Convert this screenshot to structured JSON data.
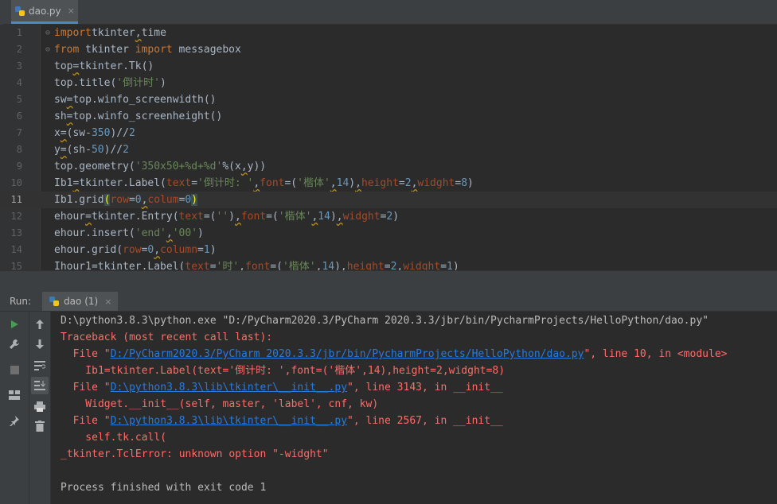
{
  "editor_tab": {
    "name": "dao.py",
    "close": "×"
  },
  "code_lines": [
    {
      "n": "1",
      "segs": [
        [
          "kw",
          "import"
        ],
        [
          "",
          "tkinter"
        ],
        [
          "wv",
          ","
        ],
        [
          "",
          "time"
        ]
      ]
    },
    {
      "n": "2",
      "segs": [
        [
          "kw",
          "from"
        ],
        [
          "",
          " tkinter "
        ],
        [
          "kw",
          "import"
        ],
        [
          "",
          " messagebox"
        ]
      ]
    },
    {
      "n": "3",
      "segs": [
        [
          "",
          "top"
        ],
        [
          "wv",
          "="
        ],
        [
          "",
          "tkinter.Tk()"
        ]
      ]
    },
    {
      "n": "4",
      "segs": [
        [
          "",
          "top.title("
        ],
        [
          "st",
          "'倒计时'"
        ],
        [
          "",
          ")"
        ]
      ]
    },
    {
      "n": "5",
      "segs": [
        [
          "",
          "sw"
        ],
        [
          "wv",
          "="
        ],
        [
          "",
          "top.winfo_screenwidth()"
        ]
      ]
    },
    {
      "n": "6",
      "segs": [
        [
          "",
          "sh"
        ],
        [
          "wv",
          "="
        ],
        [
          "",
          "top.winfo_screenheight()"
        ]
      ]
    },
    {
      "n": "7",
      "segs": [
        [
          "",
          "x"
        ],
        [
          "wv",
          "="
        ],
        [
          "",
          "(sw-"
        ],
        [
          "nu",
          "350"
        ],
        [
          "",
          ")//"
        ],
        [
          "nu",
          "2"
        ]
      ]
    },
    {
      "n": "8",
      "segs": [
        [
          "",
          "y"
        ],
        [
          "wv",
          "="
        ],
        [
          "",
          "(sh-"
        ],
        [
          "nu",
          "50"
        ],
        [
          "",
          ")//"
        ],
        [
          "nu",
          "2"
        ]
      ]
    },
    {
      "n": "9",
      "segs": [
        [
          "",
          "top.geometry("
        ],
        [
          "st",
          "'350x50+%d+%d'"
        ],
        [
          "",
          "%(x"
        ],
        [
          "wv",
          ","
        ],
        [
          "",
          "y))"
        ]
      ]
    },
    {
      "n": "10",
      "segs": [
        [
          "",
          "Ib1"
        ],
        [
          "wv",
          "="
        ],
        [
          "",
          "tkinter.Label("
        ],
        [
          "pa",
          "text"
        ],
        [
          "",
          "="
        ],
        [
          "st",
          "'倒计时: '"
        ],
        [
          "wv",
          ","
        ],
        [
          "pa",
          "font"
        ],
        [
          "",
          "=("
        ],
        [
          "st",
          "'楷体'"
        ],
        [
          "wv",
          ","
        ],
        [
          "nu",
          "14"
        ],
        [
          "",
          ")"
        ],
        [
          "wv",
          ","
        ],
        [
          "pa",
          "height"
        ],
        [
          "",
          "="
        ],
        [
          "nu",
          "2"
        ],
        [
          "wv",
          ","
        ],
        [
          "pa",
          "widght"
        ],
        [
          "",
          "="
        ],
        [
          "nu",
          "8"
        ],
        [
          "",
          ")"
        ]
      ]
    },
    {
      "n": "11",
      "segs": [
        [
          "",
          "Ib1.grid"
        ],
        [
          "br",
          "("
        ],
        [
          "pa",
          "row"
        ],
        [
          "",
          "="
        ],
        [
          "nu",
          "0"
        ],
        [
          "wv",
          ","
        ],
        [
          "pa",
          "colum"
        ],
        [
          "",
          "="
        ],
        [
          "nu",
          "0"
        ],
        [
          "br",
          ")"
        ]
      ]
    },
    {
      "n": "12",
      "segs": [
        [
          "",
          "ehour"
        ],
        [
          "wv",
          "="
        ],
        [
          "",
          "tkinter.Entry("
        ],
        [
          "pa",
          "text"
        ],
        [
          "",
          "=("
        ],
        [
          "st",
          "''"
        ],
        [
          "",
          ")"
        ],
        [
          "wv",
          ","
        ],
        [
          "pa",
          "font"
        ],
        [
          "",
          "=("
        ],
        [
          "st",
          "'楷体'"
        ],
        [
          "wv",
          ","
        ],
        [
          "nu",
          "14"
        ],
        [
          "",
          ")"
        ],
        [
          "wv",
          ","
        ],
        [
          "pa",
          "widght"
        ],
        [
          "",
          "="
        ],
        [
          "nu",
          "2"
        ],
        [
          "",
          ")"
        ]
      ]
    },
    {
      "n": "13",
      "segs": [
        [
          "",
          "ehour.insert("
        ],
        [
          "st",
          "'end'"
        ],
        [
          "wv",
          ","
        ],
        [
          "st",
          "'00'"
        ],
        [
          "",
          ")"
        ]
      ]
    },
    {
      "n": "14",
      "segs": [
        [
          "",
          "ehour.grid("
        ],
        [
          "pa",
          "row"
        ],
        [
          "",
          "="
        ],
        [
          "nu",
          "0"
        ],
        [
          "wv",
          ","
        ],
        [
          "pa",
          "column"
        ],
        [
          "",
          "="
        ],
        [
          "nu",
          "1"
        ],
        [
          "",
          ")"
        ]
      ]
    },
    {
      "n": "15",
      "segs": [
        [
          "",
          "Ihour1=tkinter.Label("
        ],
        [
          "pa",
          "text"
        ],
        [
          "",
          "="
        ],
        [
          "st",
          "'时'"
        ],
        [
          "",
          ","
        ],
        [
          "pa",
          "font"
        ],
        [
          "",
          "=("
        ],
        [
          "st",
          "'楷体'"
        ],
        [
          "",
          ","
        ],
        [
          "nu",
          "14"
        ],
        [
          "",
          "),"
        ],
        [
          "pa",
          "height"
        ],
        [
          "",
          "="
        ],
        [
          "nu",
          "2"
        ],
        [
          "",
          ","
        ],
        [
          "pa",
          "widght"
        ],
        [
          "",
          "="
        ],
        [
          "nu",
          "1"
        ],
        [
          "",
          ")"
        ]
      ]
    }
  ],
  "current_line": "11",
  "run": {
    "label": "Run:",
    "tab": "dao (1)",
    "close": "×"
  },
  "console_lines": [
    {
      "cls": "plain",
      "segs": [
        [
          "",
          "D:\\python3.8.3\\python.exe \"D:/PyCharm2020.3/PyCharm 2020.3.3/jbr/bin/PycharmProjects/HelloPython/dao.py\""
        ]
      ]
    },
    {
      "cls": "err",
      "segs": [
        [
          "",
          "Traceback (most recent call last):"
        ]
      ]
    },
    {
      "cls": "err",
      "segs": [
        [
          "",
          "  File \""
        ],
        [
          "lnk",
          "D:/PyCharm2020.3/PyCharm 2020.3.3/jbr/bin/PycharmProjects/HelloPython/dao.py"
        ],
        [
          "",
          "\", line 10, in <module>"
        ]
      ]
    },
    {
      "cls": "err",
      "segs": [
        [
          "",
          "    Ib1=tkinter.Label(text='倒计时: ',font=('楷体',14),height=2,widght=8)"
        ]
      ]
    },
    {
      "cls": "err",
      "segs": [
        [
          "",
          "  File \""
        ],
        [
          "lnk",
          "D:\\python3.8.3\\lib\\tkinter\\__init__.py"
        ],
        [
          "",
          "\", line 3143, in __init__"
        ]
      ]
    },
    {
      "cls": "err",
      "segs": [
        [
          "",
          "    Widget.__init__(self, master, 'label', cnf, kw)"
        ]
      ]
    },
    {
      "cls": "err",
      "segs": [
        [
          "",
          "  File \""
        ],
        [
          "lnk",
          "D:\\python3.8.3\\lib\\tkinter\\__init__.py"
        ],
        [
          "",
          "\", line 2567, in __init__"
        ]
      ]
    },
    {
      "cls": "err",
      "segs": [
        [
          "",
          "    self.tk.call("
        ]
      ]
    },
    {
      "cls": "err",
      "segs": [
        [
          "",
          "_tkinter.TclError: unknown option \"-widght\""
        ]
      ]
    },
    {
      "cls": "plain",
      "segs": [
        [
          "",
          ""
        ]
      ]
    },
    {
      "cls": "plain",
      "segs": [
        [
          "",
          "Process finished with exit code 1"
        ]
      ]
    }
  ]
}
